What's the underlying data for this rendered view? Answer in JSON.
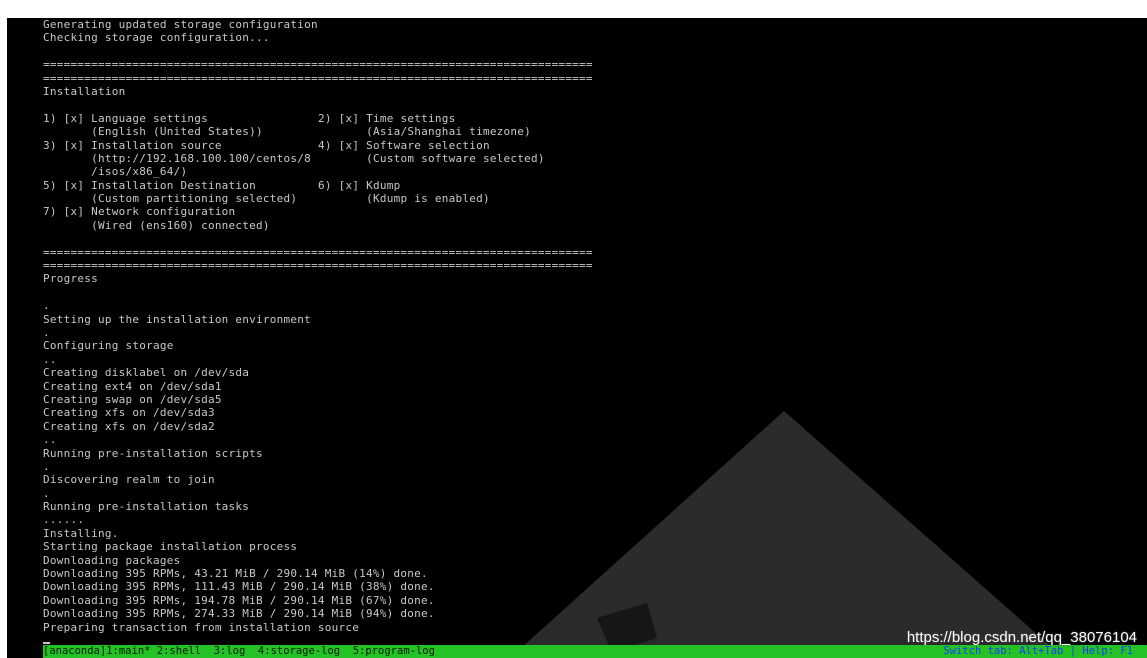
{
  "console": {
    "lines": [
      "Generating updated storage configuration",
      "Checking storage configuration...",
      "",
      "================================================================================",
      "================================================================================",
      "Installation",
      "",
      "1) [x] Language settings",
      "       (English (United States))",
      "3) [x] Installation source",
      "       (http://192.168.100.100/centos/8",
      "       /isos/x86_64/)",
      "5) [x] Installation Destination",
      "       (Custom partitioning selected)",
      "7) [x] Network configuration",
      "       (Wired (ens160) connected)",
      "",
      "================================================================================",
      "================================================================================",
      "Progress",
      "",
      ".",
      "Setting up the installation environment",
      ".",
      "Configuring storage",
      "..",
      "Creating disklabel on /dev/sda",
      "Creating ext4 on /dev/sda1",
      "Creating swap on /dev/sda5",
      "Creating xfs on /dev/sda3",
      "Creating xfs on /dev/sda2",
      "..",
      "Running pre-installation scripts",
      ".",
      "Discovering realm to join",
      ".",
      "Running pre-installation tasks",
      "......",
      "Installing.",
      "Starting package installation process",
      "Downloading packages",
      "Downloading 395 RPMs, 43.21 MiB / 290.14 MiB (14%) done.",
      "Downloading 395 RPMs, 111.43 MiB / 290.14 MiB (38%) done.",
      "Downloading 395 RPMs, 194.78 MiB / 290.14 MiB (67%) done.",
      "Downloading 395 RPMs, 274.33 MiB / 290.14 MiB (94%) done.",
      "Preparing transaction from installation source"
    ],
    "right_column": {
      "7": "2) [x] Time settings",
      "8": "       (Asia/Shanghai timezone)",
      "9": "4) [x] Software selection",
      "10": "       (Custom software selected)",
      "12": "6) [x] Kdump",
      "13": "       (Kdump is enabled)"
    }
  },
  "tmux": {
    "windows": "[anaconda]1:main* 2:shell  3:log  4:storage-log  5:program-log",
    "hint": "Switch tab: Alt+Tab | Help: F1"
  },
  "watermark": {
    "url": "https://blog.csdn.net/qq_38076104"
  },
  "colors": {
    "background": "#000000",
    "text": "#c8c8c8",
    "status_bar": "#24c224",
    "status_hint": "#1a3cff"
  }
}
